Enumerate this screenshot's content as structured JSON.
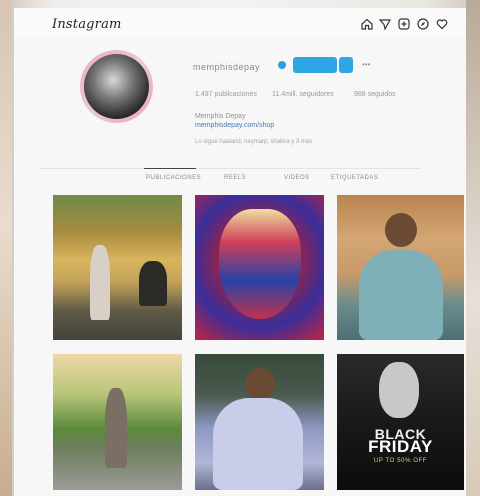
{
  "header": {
    "logo": "Instagram",
    "icons": [
      "home-icon",
      "direct-icon",
      "add-post-icon",
      "explore-icon",
      "heart-icon"
    ]
  },
  "profile": {
    "username": "memphisdepay",
    "follow_label": "",
    "stats": {
      "posts": "1.497 publicaciones",
      "followers": "11.4mill. seguidores",
      "following": "988 seguidos"
    },
    "name": "Memphis Depay",
    "link": "memphisdepay.com/shop",
    "followed_by": "Lo sigue haaland, neymarjr, shakira y 3 más"
  },
  "tabs": [
    "PUBLICACIONES",
    "REELS",
    "VIDEOS",
    "ETIQUETADAS"
  ],
  "posts": [
    {
      "alt": "post-1"
    },
    {
      "alt": "post-2"
    },
    {
      "alt": "post-3"
    },
    {
      "alt": "post-4"
    },
    {
      "alt": "post-5"
    },
    {
      "alt": "post-6",
      "text_top": "BLACK",
      "text_main": "FRIDAY",
      "text_sub": "UP TO 50% OFF"
    }
  ],
  "colors": {
    "accent": "#2ea6e6",
    "ring": "#f4a6c9"
  }
}
